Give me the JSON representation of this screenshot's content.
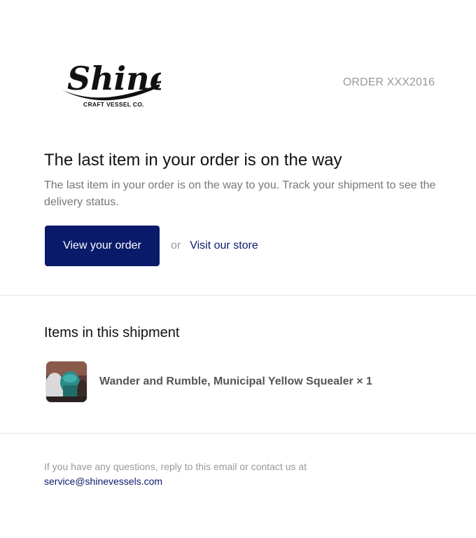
{
  "brand": {
    "logo_word": "Shine",
    "logo_tagline": "CRAFT VESSEL CO."
  },
  "order": {
    "number_label": "ORDER XXX2016"
  },
  "main": {
    "headline": "The last item in your order is on the way",
    "body": "The last item in your order is on the way to you. Track your shipment to see the delivery status.",
    "primary_button": "View your order",
    "or_text": "or",
    "store_link": "Visit our store"
  },
  "shipment": {
    "title": "Items in this shipment",
    "items": [
      {
        "label": "Wander and Rumble, Municipal Yellow Squealer × 1",
        "thumbnail": "product-photo"
      }
    ]
  },
  "footer": {
    "text": "If you have any questions, reply to this email or contact us at",
    "email": "service@shinevessels.com"
  },
  "colors": {
    "accent": "#0a1a6b",
    "muted_text": "#777777",
    "light_text": "#999999",
    "divider": "#e5e5e5"
  }
}
